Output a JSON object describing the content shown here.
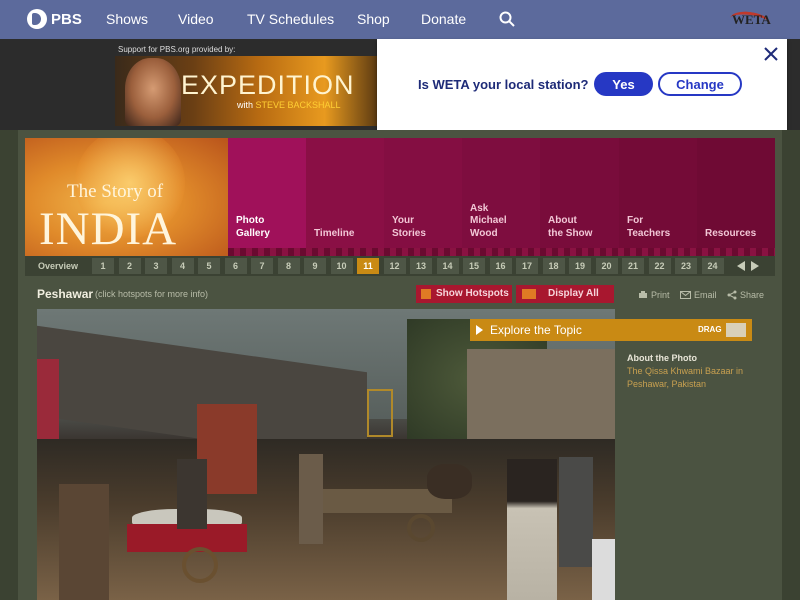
{
  "nav": {
    "brand": "PBS",
    "items": [
      "Shows",
      "Video",
      "TV Schedules",
      "Shop",
      "Donate"
    ],
    "station_logo": "WETA"
  },
  "ad": {
    "label": "Support for PBS.org provided by:",
    "title": "EXPEDITION",
    "subtitle_prefix": "with",
    "subtitle_host": "STEVE BACKSHALL"
  },
  "popup": {
    "question": "Is WETA your local station?",
    "yes_label": "Yes",
    "change_label": "Change"
  },
  "header": {
    "title_line1": "The Story of",
    "title_line2": "INDIA",
    "tabs": [
      {
        "line1": "Photo",
        "line2": "Gallery",
        "line3": "",
        "active": true
      },
      {
        "line1": "",
        "line2": "Timeline",
        "line3": "",
        "active": false
      },
      {
        "line1": "Your",
        "line2": "Stories",
        "line3": "",
        "active": false
      },
      {
        "line1": "Ask",
        "line2": "Michael",
        "line3": "Wood",
        "active": false
      },
      {
        "line1": "About",
        "line2": "the Show",
        "line3": "",
        "active": false
      },
      {
        "line1": "For",
        "line2": "Teachers",
        "line3": "",
        "active": false
      },
      {
        "line1": "",
        "line2": "Resources",
        "line3": "",
        "active": false
      }
    ]
  },
  "pager": {
    "overview": "Overview",
    "pages": [
      "1",
      "2",
      "3",
      "4",
      "5",
      "6",
      "7",
      "8",
      "9",
      "10",
      "11",
      "12",
      "13",
      "14",
      "15",
      "16",
      "17",
      "18",
      "19",
      "20",
      "21",
      "22",
      "23",
      "24"
    ],
    "current": "11"
  },
  "photo": {
    "title": "Peshawar",
    "hint": "(click hotspots for more info)",
    "show_hotspots": "Show Hotspots",
    "display_all": "Display All",
    "print": "Print",
    "email": "Email",
    "share": "Share"
  },
  "explore": {
    "label": "Explore the Topic",
    "drag": "DRAG"
  },
  "about": {
    "heading": "About the Photo",
    "text": "The Qissa Khwami Bazaar in Peshawar, Pakistan"
  },
  "colors": {
    "nav_bg": "#5c6a9c",
    "tab_magenta": "#a0115a",
    "tab_dark": "#7a0d3a",
    "accent_orange": "#c98a14",
    "hotspot_red": "#a8172f",
    "popup_blue": "#2638c4"
  }
}
